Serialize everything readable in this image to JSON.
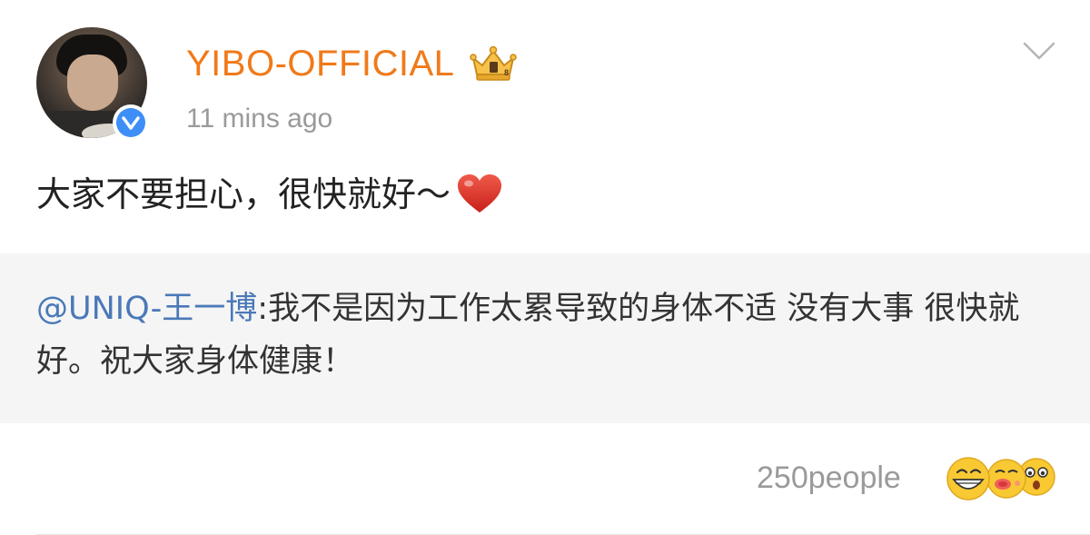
{
  "post": {
    "username": "YIBO-OFFICIAL",
    "timestamp": "11 mins ago",
    "content_text": "大家不要担心，很快就好～",
    "content_emoji": "heart-emoji"
  },
  "repost": {
    "mention": "@UNIQ-王一博",
    "text": ":我不是因为工作太累导致的身体不适 没有大事 很快就好。祝大家身体健康！"
  },
  "reactions": {
    "count_label": "250people",
    "emoji_icons": [
      "grinning-face-icon",
      "kissing-face-icon",
      "surprised-face-icon"
    ]
  },
  "icons": {
    "avatar": "profile-avatar",
    "verified": "verified-badge-icon",
    "crown": "crown-icon",
    "menu": "chevron-down-icon"
  },
  "colors": {
    "username": "#f07a1a",
    "mention": "#4a79b8",
    "verified": "#3e8ef7",
    "quote_bg": "#f5f5f5",
    "meta_text": "#9a9a9a"
  }
}
